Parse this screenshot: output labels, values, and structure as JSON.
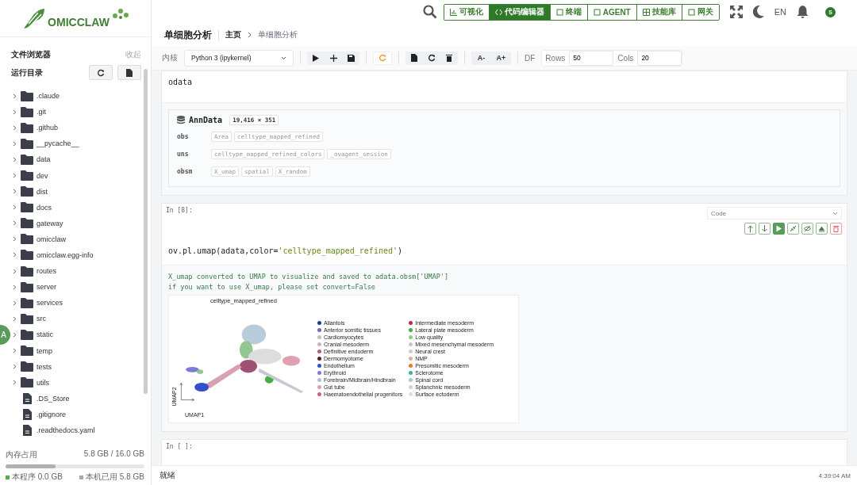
{
  "app": {
    "logo_text": "OMICCLAW"
  },
  "nav": {
    "tabs": [
      {
        "label": "可视化",
        "selected": false
      },
      {
        "label": "代码编辑器",
        "selected": true
      },
      {
        "label": "终端",
        "selected": false
      },
      {
        "label": "AGENT",
        "selected": false
      },
      {
        "label": "技能库",
        "selected": false
      },
      {
        "label": "网关",
        "selected": false
      }
    ],
    "language": "EN",
    "user_initial": "S"
  },
  "sidebar": {
    "title": "文件浏览器",
    "collapse": "收起",
    "section": "运行目录",
    "items": [
      {
        "name": ".claude",
        "kind": "folder"
      },
      {
        "name": ".git",
        "kind": "folder"
      },
      {
        "name": ".github",
        "kind": "folder"
      },
      {
        "name": "__pycache__",
        "kind": "folder"
      },
      {
        "name": "data",
        "kind": "folder"
      },
      {
        "name": "dev",
        "kind": "folder"
      },
      {
        "name": "dist",
        "kind": "folder"
      },
      {
        "name": "docs",
        "kind": "folder"
      },
      {
        "name": "gateway",
        "kind": "folder"
      },
      {
        "name": "omicclaw",
        "kind": "folder"
      },
      {
        "name": "omicclaw.egg-info",
        "kind": "folder"
      },
      {
        "name": "routes",
        "kind": "folder"
      },
      {
        "name": "server",
        "kind": "folder"
      },
      {
        "name": "services",
        "kind": "folder"
      },
      {
        "name": "src",
        "kind": "folder"
      },
      {
        "name": "static",
        "kind": "folder"
      },
      {
        "name": "temp",
        "kind": "folder"
      },
      {
        "name": "tests",
        "kind": "folder"
      },
      {
        "name": "utils",
        "kind": "folder"
      },
      {
        "name": ".DS_Store",
        "kind": "file"
      },
      {
        "name": ".gitignore",
        "kind": "file"
      },
      {
        "name": ".readthedocs.yaml",
        "kind": "file"
      }
    ],
    "memory": {
      "label": "内存占用",
      "reading": "5.8 GB / 16.0 GB",
      "level": 0.36,
      "app_usage": "本程序 0.0 GB",
      "system_usage": "本机已用 5.8 GB"
    },
    "floating_badge": "A"
  },
  "header": {
    "title": "单细胞分析",
    "breadcrumb": [
      "主页",
      "单细胞分析"
    ]
  },
  "toolbar": {
    "kernel_label": "内核",
    "kernel": "Python 3 (ipykernel)",
    "font_smaller": "A-",
    "font_larger": "A+",
    "df_label": "DF",
    "rows_label": "Rows",
    "rows": "50",
    "cols_label": "Cols",
    "cols": "20"
  },
  "cells": [
    {
      "kind": "code",
      "code": "odata",
      "output": {
        "kind": "anndata",
        "title": "AnnData",
        "shape": "19,416 × 351",
        "fields": [
          {
            "key": "obs",
            "values": [
              "Area",
              "celltype_mapped_refined"
            ]
          },
          {
            "key": "uns",
            "values": [
              "celltype_mapped_refined_colors",
              "_ovagent_session"
            ]
          },
          {
            "key": "obsm",
            "values": [
              "X_umap",
              "spatial",
              "X_random"
            ]
          }
        ]
      }
    },
    {
      "kind": "code",
      "prompt": "In [8]:",
      "cell_type": "Code",
      "code_parts": [
        "ov.pl.umap(adata,color=",
        "'celltype_mapped_refined'",
        ")"
      ],
      "output": {
        "kind": "plot",
        "log": [
          "X_umap converted to UMAP to visualize and saved to adata.obsm['UMAP']",
          "if you want to use X_umap, please set convert=False"
        ],
        "plot_title": "celltype_mapped_refined",
        "xlabel": "UMAP1",
        "ylabel": "UMAP2",
        "legend": [
          {
            "label": "Allantois",
            "color": "#1f3a93"
          },
          {
            "label": "Anterior somitic tissues",
            "color": "#6c6cb4"
          },
          {
            "label": "Cardiomyocytes",
            "color": "#c0c0c0"
          },
          {
            "label": "Cranial mesoderm",
            "color": "#c8b8b8"
          },
          {
            "label": "Definitive endoderm",
            "color": "#b06070"
          },
          {
            "label": "Dermomyotome",
            "color": "#6b1a2a"
          },
          {
            "label": "Endothelium",
            "color": "#3050d0"
          },
          {
            "label": "Erythroid",
            "color": "#7b7bd8"
          },
          {
            "label": "Forebrain/Midbrain/Hindbrain",
            "color": "#b8b8e0"
          },
          {
            "label": "Gut tube",
            "color": "#d8a0b0"
          },
          {
            "label": "Haematoendothelial progenitors",
            "color": "#d06080"
          },
          {
            "label": "Intermediate mesoderm",
            "color": "#b03050"
          },
          {
            "label": "Lateral plate mesoderm",
            "color": "#40b040"
          },
          {
            "label": "Low quality",
            "color": "#90c890"
          },
          {
            "label": "Mixed mesenchymal mesoderm",
            "color": "#c8c8c8"
          },
          {
            "label": "Neural crest",
            "color": "#cccccc"
          },
          {
            "label": "NMP",
            "color": "#e0b090"
          },
          {
            "label": "Presomitic mesoderm",
            "color": "#e08020"
          },
          {
            "label": "Sclerotome",
            "color": "#40b0a0"
          },
          {
            "label": "Spinal cord",
            "color": "#a0d0c0"
          },
          {
            "label": "Splanchnic mesoderm",
            "color": "#d0d0d0"
          },
          {
            "label": "Surface ectoderm",
            "color": "#e0e0e0"
          }
        ]
      }
    },
    {
      "kind": "empty",
      "prompt": "In [ ]:"
    }
  ],
  "status_bar": {
    "status": "就绪",
    "time": "4:39:04 AM"
  }
}
